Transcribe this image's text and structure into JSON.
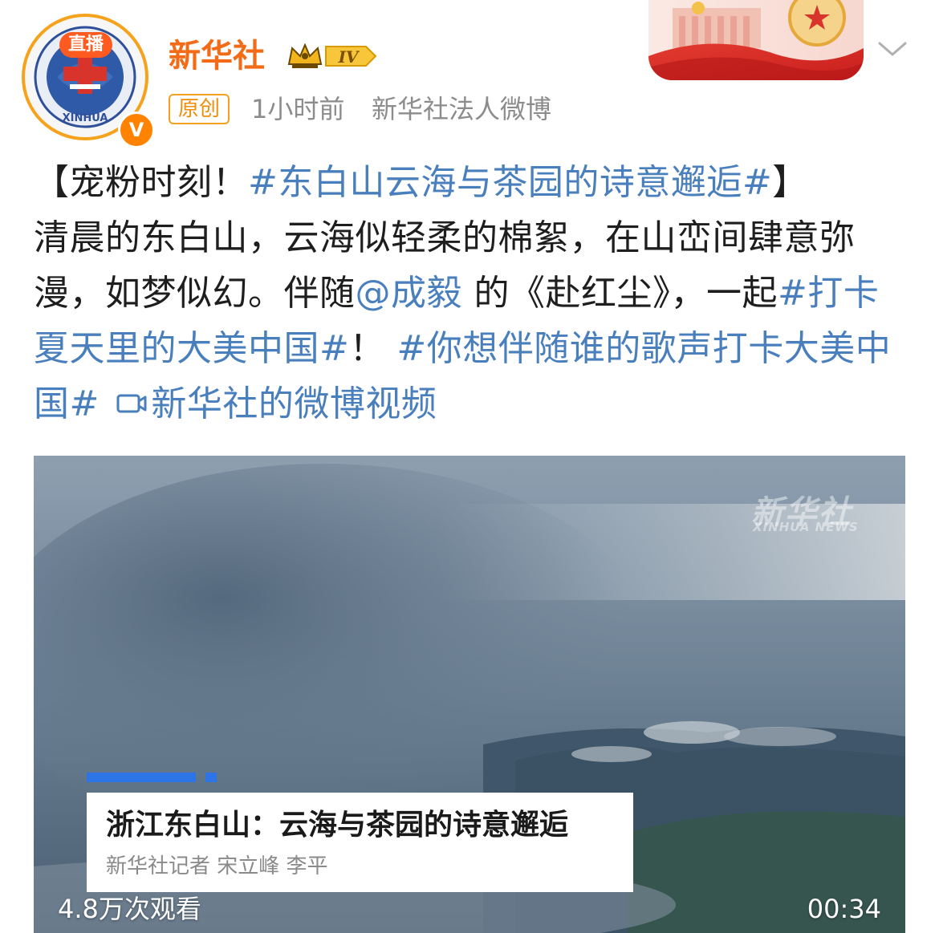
{
  "header": {
    "username": "新华社",
    "live_badge": "直播",
    "verify_mark": "V",
    "vip_level": "IV",
    "origin_tag": "原创",
    "time": "1小时前",
    "source": "新华社法人微博",
    "avatar_text": "XINHUA"
  },
  "post": {
    "bracket_open": "【",
    "lead": "宠粉时刻！",
    "topic1": "#东白山云海与茶园的诗意邂逅#",
    "bracket_close": "】",
    "body1": "清晨的东白山，云海似轻柔的棉絮，在山峦间肆意弥漫，如梦似幻。伴随",
    "mention": "@成毅",
    "body2": " 的《赴红尘》，一起",
    "topic2": "#打卡夏天里的大美中国#",
    "body3": "！ ",
    "topic3": "#你想伴随谁的歌声打卡大美中国#",
    "video_link": "新华社的微博视频"
  },
  "video": {
    "watermark_cn": "新华社",
    "watermark_en": "XINHUA NEWS",
    "caption_title": "浙江东白山：云海与茶园的诗意邂逅",
    "caption_sub": "新华社记者 宋立峰 李平",
    "views": "4.8万次观看",
    "duration": "00:34"
  },
  "colors": {
    "username": "#f36b16",
    "link": "#4a7fbd",
    "meta": "#8c8c8c",
    "accent_orange": "#ff8200"
  }
}
